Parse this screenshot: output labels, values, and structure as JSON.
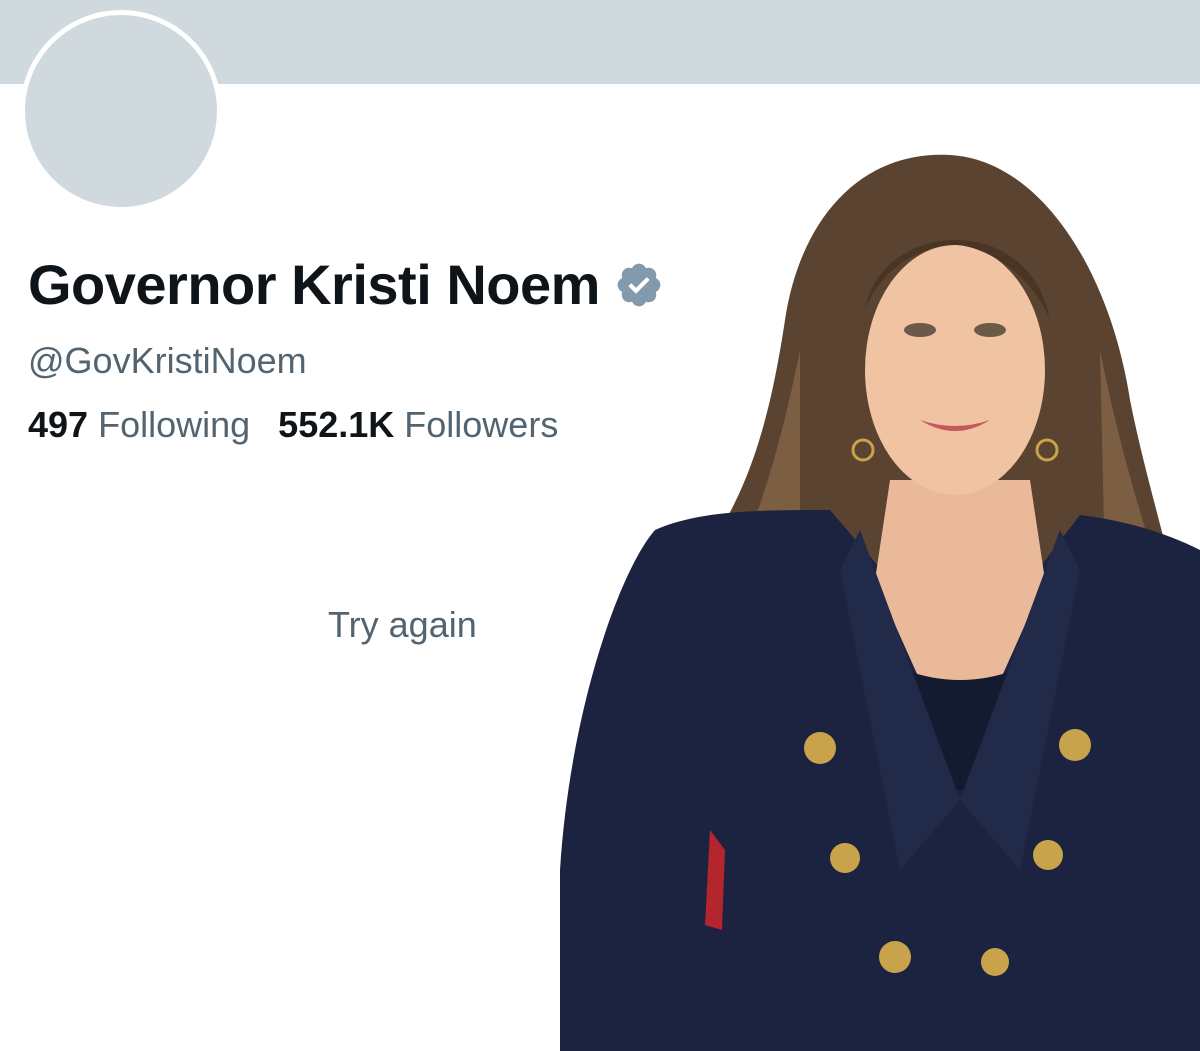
{
  "profile": {
    "display_name": "Governor Kristi Noem",
    "handle": "@GovKristiNoem",
    "verified_icon": "verified-badge-icon",
    "following_count": "497",
    "following_label": "Following",
    "followers_count": "552.1K",
    "followers_label": "Followers"
  },
  "content": {
    "retry_label": "Try again"
  },
  "colors": {
    "banner": "#cfd9de",
    "text_primary": "#0f1419",
    "text_secondary": "#536471",
    "verified_badge": "#829aab"
  }
}
